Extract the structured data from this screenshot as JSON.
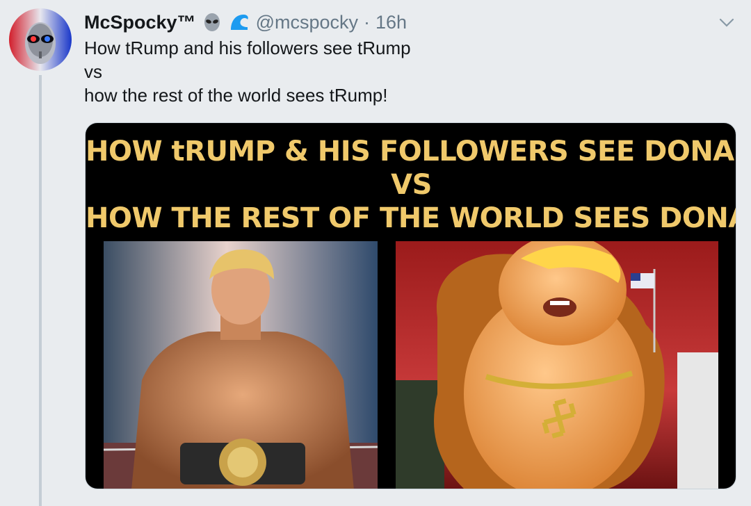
{
  "tweet": {
    "display_name": "McSpocky™",
    "handle": "@mcspocky",
    "separator": "·",
    "time": "16h",
    "badge_icons": [
      "alien-icon",
      "wave-icon"
    ],
    "text_lines": [
      "How tRump and his followers see tRump",
      "vs",
      "how the rest of the world sees tRump!"
    ]
  },
  "media": {
    "headline_lines": [
      "HOW tRUMP & HIS FOLLOWERS SEE DONALD",
      "VS",
      "HOW THE REST OF THE WORLD SEES DONALD"
    ],
    "left_panel": "boxer-photo",
    "right_panel": "baby-balloon-photo"
  },
  "colors": {
    "background": "#e9ecef",
    "headline": "#f0c96b",
    "muted": "#657786",
    "text": "#14171a",
    "badge_blue": "#1d9bf0"
  }
}
